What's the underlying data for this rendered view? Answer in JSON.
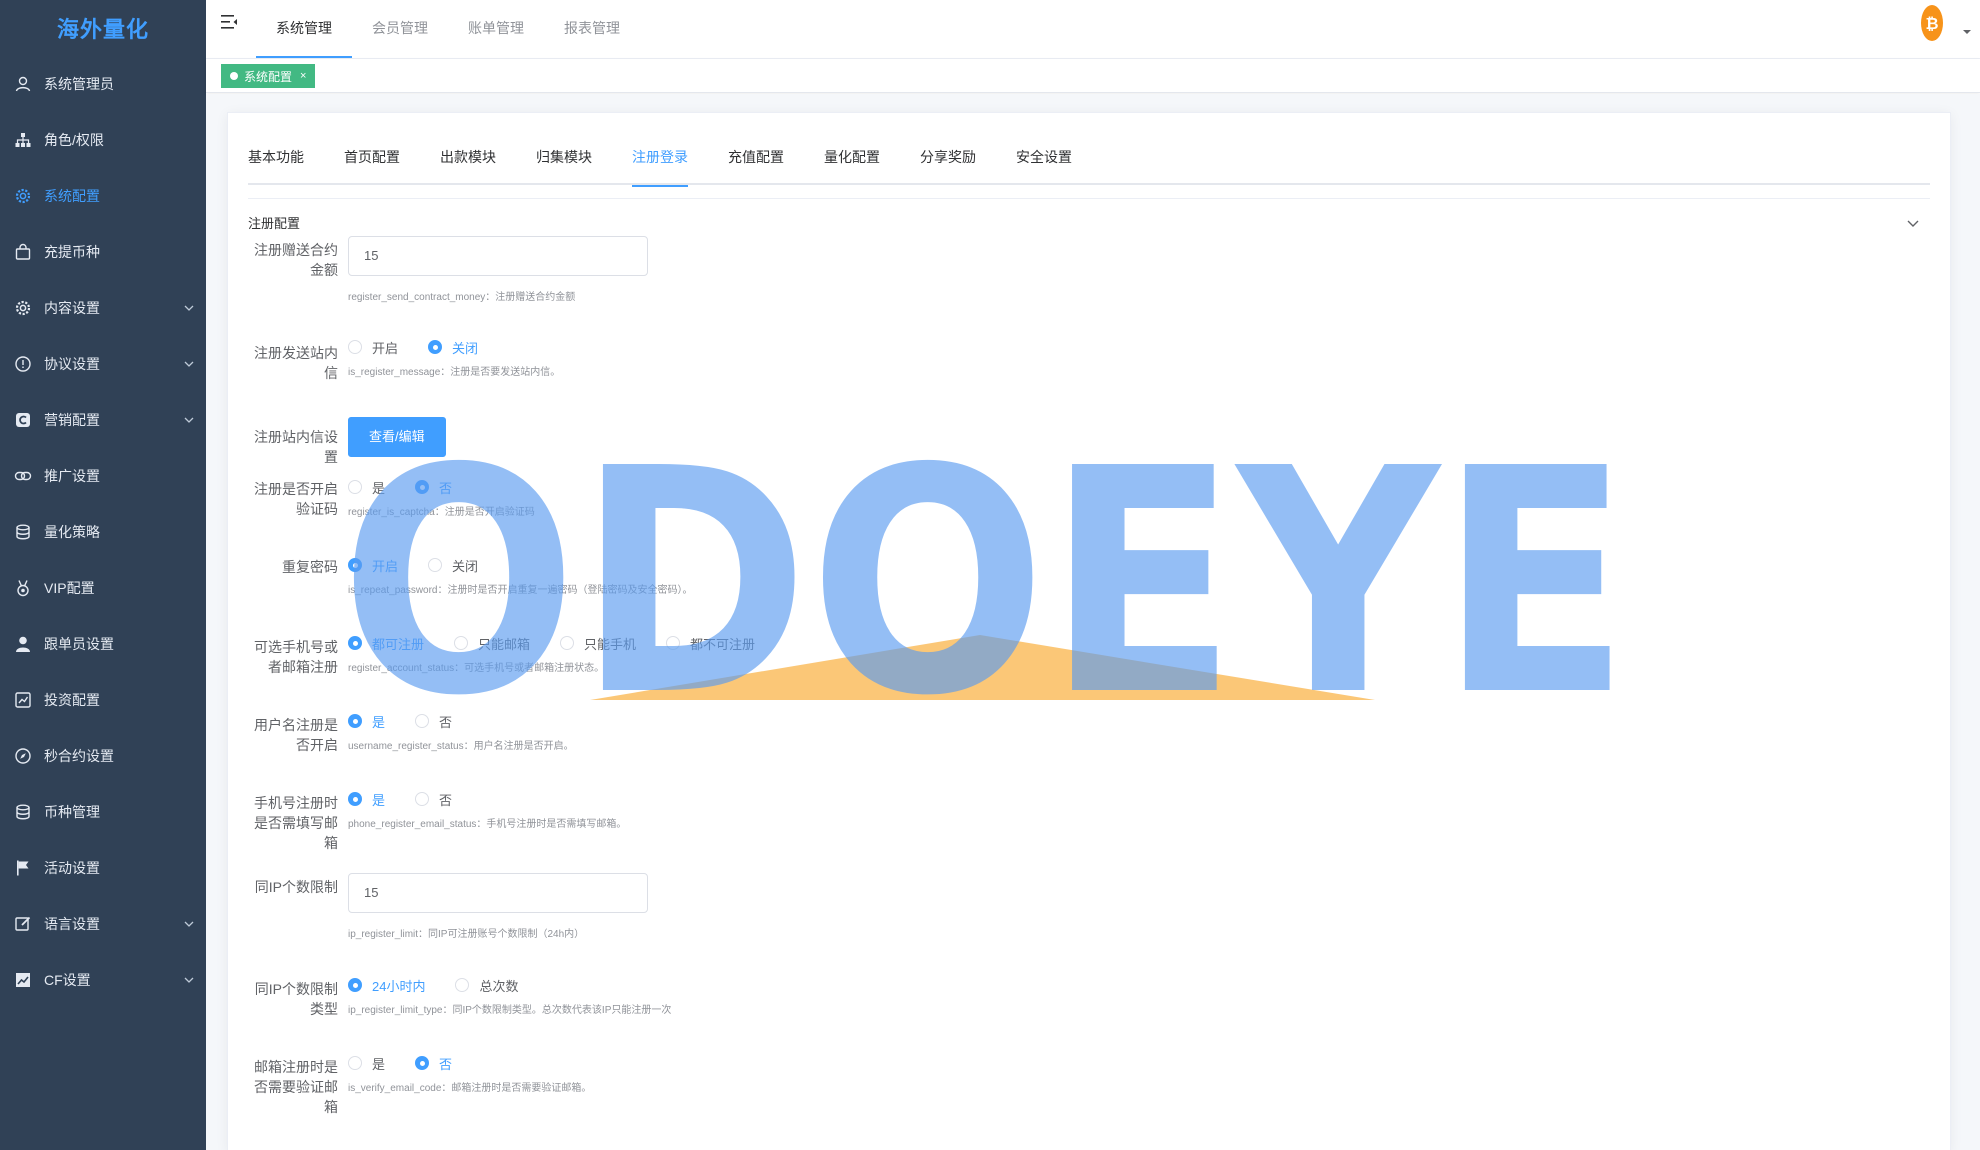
{
  "sidebar": {
    "logo": "海外量化",
    "items": [
      {
        "label": "系统管理员",
        "icon": "user-icon",
        "expandable": false,
        "active": false
      },
      {
        "label": "角色/权限",
        "icon": "org-chart-icon",
        "expandable": false,
        "active": false
      },
      {
        "label": "系统配置",
        "icon": "gear-icon",
        "expandable": false,
        "active": true
      },
      {
        "label": "充提币种",
        "icon": "bag-icon",
        "expandable": false,
        "active": false
      },
      {
        "label": "内容设置",
        "icon": "gear-icon",
        "expandable": true,
        "active": false
      },
      {
        "label": "协议设置",
        "icon": "info-circle-icon",
        "expandable": true,
        "active": false
      },
      {
        "label": "营销配置",
        "icon": "marketing-icon",
        "expandable": true,
        "active": false
      },
      {
        "label": "推广设置",
        "icon": "link-icon",
        "expandable": false,
        "active": false
      },
      {
        "label": "量化策略",
        "icon": "database-icon",
        "expandable": false,
        "active": false
      },
      {
        "label": "VIP配置",
        "icon": "medal-icon",
        "expandable": false,
        "active": false
      },
      {
        "label": "跟单员设置",
        "icon": "person-icon",
        "expandable": false,
        "active": false
      },
      {
        "label": "投资配置",
        "icon": "invest-icon",
        "expandable": false,
        "active": false
      },
      {
        "label": "秒合约设置",
        "icon": "compass-icon",
        "expandable": false,
        "active": false
      },
      {
        "label": "币种管理",
        "icon": "database-icon",
        "expandable": false,
        "active": false
      },
      {
        "label": "活动设置",
        "icon": "flag-icon",
        "expandable": false,
        "active": false
      },
      {
        "label": "语言设置",
        "icon": "edit-icon",
        "expandable": true,
        "active": false
      },
      {
        "label": "CF设置",
        "icon": "chart-icon",
        "expandable": true,
        "active": false
      }
    ]
  },
  "topbar": {
    "tabs": [
      {
        "label": "系统管理",
        "active": true
      },
      {
        "label": "会员管理",
        "active": false
      },
      {
        "label": "账单管理",
        "active": false
      },
      {
        "label": "报表管理",
        "active": false
      }
    ],
    "avatar_icon": "bitcoin-icon"
  },
  "tagbar": {
    "tag_label": "系统配置",
    "close": "×"
  },
  "config_tabs": [
    {
      "label": "基本功能",
      "active": false
    },
    {
      "label": "首页配置",
      "active": false
    },
    {
      "label": "出款模块",
      "active": false
    },
    {
      "label": "归集模块",
      "active": false
    },
    {
      "label": "注册登录",
      "active": true
    },
    {
      "label": "充值配置",
      "active": false
    },
    {
      "label": "量化配置",
      "active": false
    },
    {
      "label": "分享奖励",
      "active": false
    },
    {
      "label": "安全设置",
      "active": false
    }
  ],
  "section": {
    "title": "注册配置"
  },
  "form": {
    "send_contract_money": {
      "label": "注册赠送合约金额",
      "value": "15",
      "hint": "register_send_contract_money：注册赠送合约金额"
    },
    "register_message": {
      "label": "注册发送站内信",
      "options": [
        {
          "label": "开启",
          "checked": false
        },
        {
          "label": "关闭",
          "checked": true
        }
      ],
      "hint": "is_register_message：注册是否要发送站内信。"
    },
    "message_setting": {
      "label": "注册站内信设置",
      "button": "查看/编辑"
    },
    "captcha": {
      "label": "注册是否开启验证码",
      "options": [
        {
          "label": "是",
          "checked": false
        },
        {
          "label": "否",
          "checked": true
        }
      ],
      "hint": "register_is_captcha：注册是否开启验证码"
    },
    "repeat_password": {
      "label": "重复密码",
      "options": [
        {
          "label": "开启",
          "checked": true
        },
        {
          "label": "关闭",
          "checked": false
        }
      ],
      "hint": "is_repeat_password：注册时是否开启重复一遍密码（登陆密码及安全密码）。"
    },
    "account_status": {
      "label": "可选手机号或者邮箱注册",
      "options": [
        {
          "label": "都可注册",
          "checked": true
        },
        {
          "label": "只能邮箱",
          "checked": false
        },
        {
          "label": "只能手机",
          "checked": false
        },
        {
          "label": "都不可注册",
          "checked": false
        }
      ],
      "hint": "register_account_status：可选手机号或者邮箱注册状态。"
    },
    "username_register": {
      "label": "用户名注册是否开启",
      "options": [
        {
          "label": "是",
          "checked": true
        },
        {
          "label": "否",
          "checked": false
        }
      ],
      "hint": "username_register_status：用户名注册是否开启。"
    },
    "phone_email": {
      "label": "手机号注册时是否需填写邮箱",
      "options": [
        {
          "label": "是",
          "checked": true
        },
        {
          "label": "否",
          "checked": false
        }
      ],
      "hint": "phone_register_email_status：手机号注册时是否需填写邮箱。"
    },
    "ip_limit": {
      "label": "同IP个数限制",
      "value": "15",
      "hint": "ip_register_limit：同IP可注册账号个数限制（24h内）"
    },
    "ip_limit_type": {
      "label": "同IP个数限制类型",
      "options": [
        {
          "label": "24小时内",
          "checked": true
        },
        {
          "label": "总次数",
          "checked": false
        }
      ],
      "hint": "ip_register_limit_type：同IP个数限制类型。总次数代表该IP只能注册一次"
    },
    "verify_email": {
      "label": "邮箱注册时是否需要验证邮箱",
      "options": [
        {
          "label": "是",
          "checked": false
        },
        {
          "label": "否",
          "checked": true
        }
      ],
      "hint": "is_verify_email_code：邮箱注册时是否需要验证邮箱。"
    }
  },
  "watermark": {
    "text": "ODOEYE"
  }
}
